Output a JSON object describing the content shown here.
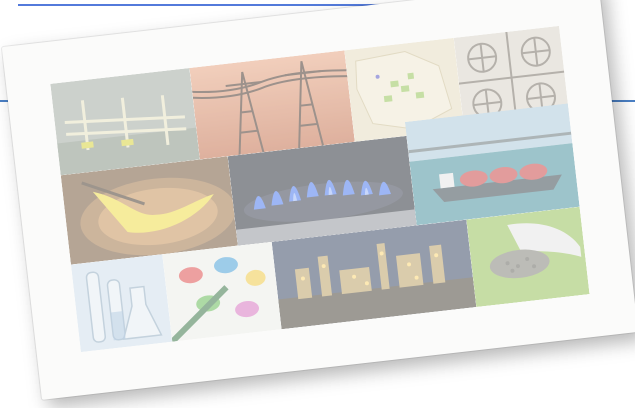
{
  "colors": {
    "link_blue": "#1a4fcf",
    "rule_blue": "#4a7fc4",
    "card_bg": "#fbfbfa"
  },
  "collage": {
    "tiles": [
      {
        "name": "gas-pipeline-tile",
        "icon": "pipeline-icon"
      },
      {
        "name": "power-lines-tile",
        "icon": "power-tower-icon"
      },
      {
        "name": "map-tile",
        "icon": "map-icon"
      },
      {
        "name": "tile-pattern-tile",
        "icon": "ornament-icon"
      },
      {
        "name": "furnace-tile",
        "icon": "flame-icon"
      },
      {
        "name": "gas-burner-tile",
        "icon": "blue-flame-icon"
      },
      {
        "name": "lng-ship-tile",
        "icon": "ship-icon"
      },
      {
        "name": "lab-glassware-tile",
        "icon": "flask-icon"
      },
      {
        "name": "paint-pigments-tile",
        "icon": "palette-icon"
      },
      {
        "name": "refinery-night-tile",
        "icon": "factory-icon"
      },
      {
        "name": "fertilizer-hand-tile",
        "icon": "grain-icon"
      }
    ]
  }
}
